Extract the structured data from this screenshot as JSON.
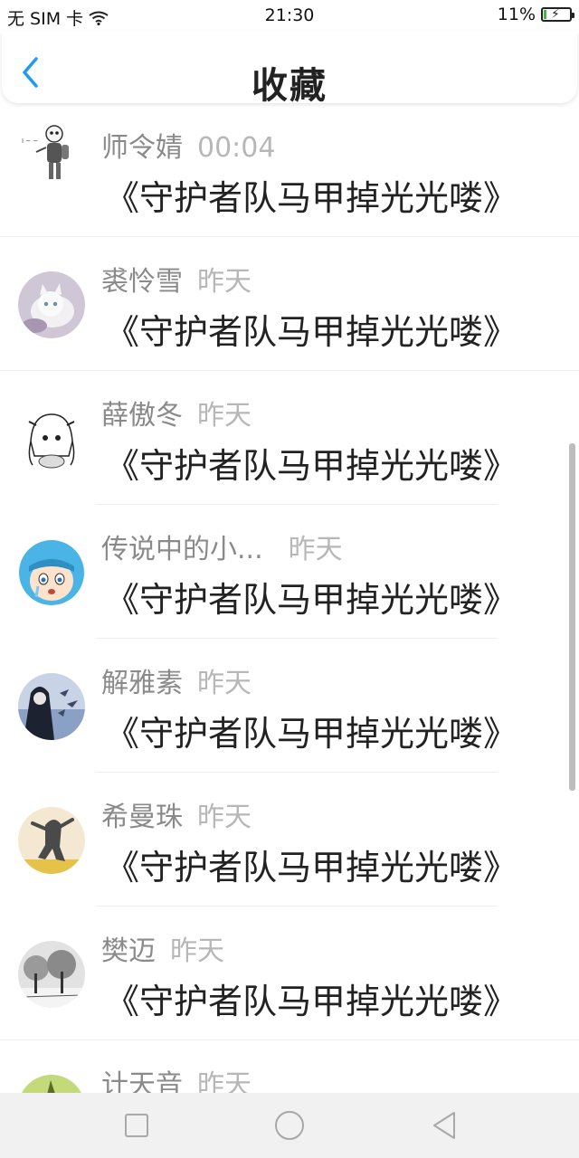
{
  "status_bar": {
    "carrier": "无 SIM 卡",
    "time": "21:30",
    "battery_percent": "11%",
    "battery_level": 0.11,
    "icons": [
      "wifi-icon",
      "battery-charging-icon"
    ]
  },
  "header": {
    "title": "收藏",
    "back_icon": "chevron-left-icon",
    "accent_color": "#1e9bf0"
  },
  "favorites": [
    {
      "name": "师令婧",
      "time": "00:04",
      "title": "《守护者队马甲掉光光喽》",
      "avatar": "sketch-character"
    },
    {
      "name": "裘怜雪",
      "time": "昨天",
      "title": "《守护者队马甲掉光光喽》",
      "avatar": "white-cat"
    },
    {
      "name": "薛傲冬",
      "time": "昨天",
      "title": "《守护者队马甲掉光光喽》",
      "avatar": "manga-girl"
    },
    {
      "name": "传说中的小...",
      "time": "昨天",
      "title": "《守护者队马甲掉光光喽》",
      "avatar": "crying-cartoon"
    },
    {
      "name": "解雅素",
      "time": "昨天",
      "title": "《守护者队马甲掉光光喽》",
      "avatar": "dark-girl-birds"
    },
    {
      "name": "希曼珠",
      "time": "昨天",
      "title": "《守护者队马甲掉光光喽》",
      "avatar": "dancing-cat"
    },
    {
      "name": "樊迈",
      "time": "昨天",
      "title": "《守护者队马甲掉光光喽》",
      "avatar": "snowy-trees"
    },
    {
      "name": "计天音",
      "time": "昨天",
      "title": "",
      "avatar": "green-plant"
    }
  ],
  "nav_bar": {
    "icons": [
      "recent-apps-icon",
      "home-icon",
      "back-icon"
    ]
  }
}
